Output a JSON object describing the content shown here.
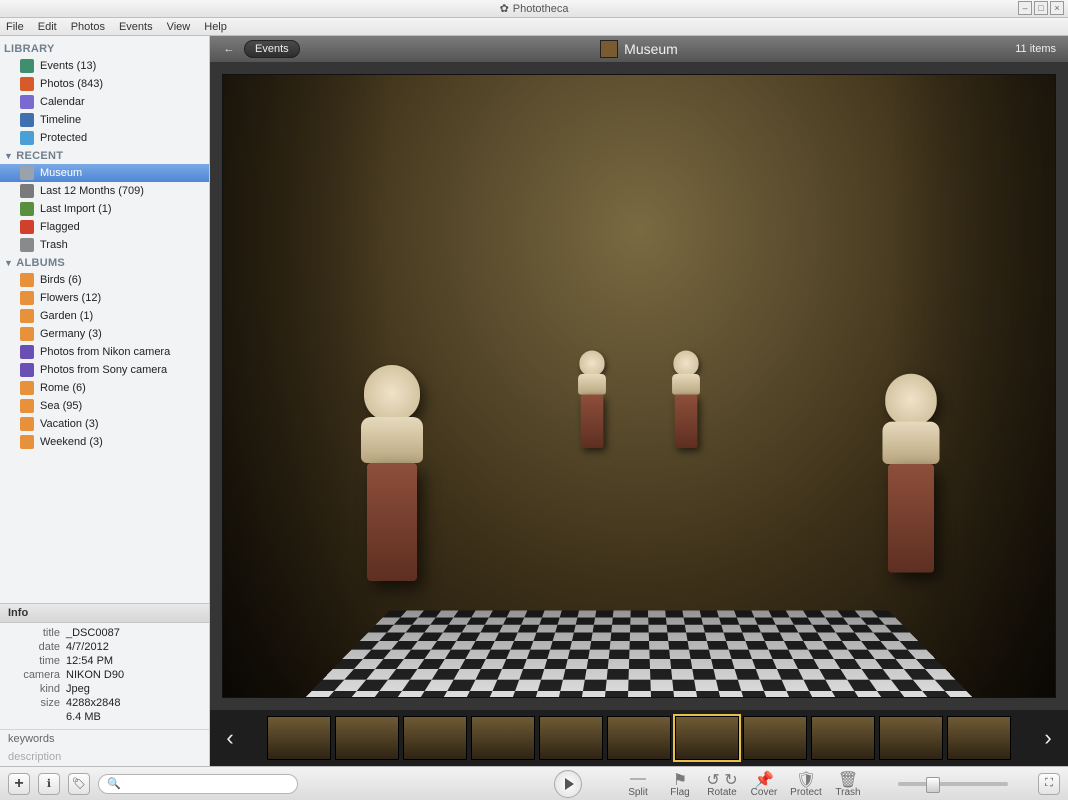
{
  "app_name": "Phototheca",
  "menus": [
    "File",
    "Edit",
    "Photos",
    "Events",
    "View",
    "Help"
  ],
  "window_controls": [
    "min",
    "max",
    "close"
  ],
  "sidebar": {
    "sections": [
      {
        "title": "LIBRARY",
        "collapsible": false,
        "items": [
          {
            "label": "Events (13)",
            "icon": "events-icon",
            "icon_bg": "#3f8f6f"
          },
          {
            "label": "Photos (843)",
            "icon": "photos-icon",
            "icon_bg": "#d65a2a"
          },
          {
            "label": "Calendar",
            "icon": "calendar-icon",
            "icon_bg": "#7a6ad0"
          },
          {
            "label": "Timeline",
            "icon": "timeline-icon",
            "icon_bg": "#3f6fae"
          },
          {
            "label": "Protected",
            "icon": "protected-icon",
            "icon_bg": "#4aa0d6"
          }
        ]
      },
      {
        "title": "RECENT",
        "collapsible": true,
        "items": [
          {
            "label": "Museum",
            "icon": "album-icon",
            "icon_bg": "#9aa3ac",
            "selected": true
          },
          {
            "label": "Last 12 Months (709)",
            "icon": "clock-icon",
            "icon_bg": "#7a7a7a"
          },
          {
            "label": "Last Import (1)",
            "icon": "import-icon",
            "icon_bg": "#5a8f3f"
          },
          {
            "label": "Flagged",
            "icon": "flag-icon",
            "icon_bg": "#d0402a"
          },
          {
            "label": "Trash",
            "icon": "trash-icon",
            "icon_bg": "#8a8a8a"
          }
        ]
      },
      {
        "title": "ALBUMS",
        "collapsible": true,
        "items": [
          {
            "label": "Birds (6)",
            "icon": "folder-icon",
            "icon_bg": "#e7913a"
          },
          {
            "label": "Flowers (12)",
            "icon": "folder-icon",
            "icon_bg": "#e7913a"
          },
          {
            "label": "Garden (1)",
            "icon": "folder-icon",
            "icon_bg": "#e7913a"
          },
          {
            "label": "Germany (3)",
            "icon": "folder-icon",
            "icon_bg": "#e7913a"
          },
          {
            "label": "Photos from Nikon camera",
            "icon": "smart-icon",
            "icon_bg": "#6a4fb5"
          },
          {
            "label": "Photos from Sony camera",
            "icon": "smart-icon",
            "icon_bg": "#6a4fb5"
          },
          {
            "label": "Rome (6)",
            "icon": "folder-icon",
            "icon_bg": "#e7913a"
          },
          {
            "label": "Sea (95)",
            "icon": "folder-icon",
            "icon_bg": "#e7913a"
          },
          {
            "label": "Vacation (3)",
            "icon": "folder-icon",
            "icon_bg": "#e7913a"
          },
          {
            "label": "Weekend (3)",
            "icon": "folder-icon",
            "icon_bg": "#e7913a"
          }
        ]
      }
    ]
  },
  "info_panel": {
    "heading": "Info",
    "rows": [
      {
        "label": "title",
        "value": "_DSC0087"
      },
      {
        "label": "date",
        "value": "4/7/2012"
      },
      {
        "label": "time",
        "value": "12:54 PM"
      },
      {
        "label": "camera",
        "value": "NIKON D90"
      },
      {
        "label": "kind",
        "value": "Jpeg"
      },
      {
        "label": "size",
        "value": "4288x2848"
      },
      {
        "label": "",
        "value": "6.4 MB"
      }
    ],
    "keywords_label": "keywords",
    "description_label": "description"
  },
  "content": {
    "breadcrumb_back_icon": "←",
    "breadcrumb_label": "Events",
    "title": "Museum",
    "item_count_label": "11 items",
    "thumbnails": {
      "count": 11,
      "selected_index": 6
    }
  },
  "bottom": {
    "add_label": "+",
    "tools": [
      {
        "name": "split",
        "label": "Split",
        "glyph": "⎯⎯"
      },
      {
        "name": "flag",
        "label": "Flag",
        "glyph": "⚑"
      },
      {
        "name": "rotate",
        "label": "Rotate",
        "glyph": "↺ ↻"
      },
      {
        "name": "cover",
        "label": "Cover",
        "glyph": "📌"
      },
      {
        "name": "protect",
        "label": "Protect",
        "glyph": "🛡"
      },
      {
        "name": "trash",
        "label": "Trash",
        "glyph": "🗑"
      }
    ],
    "search_placeholder": "",
    "fullscreen_glyph": "⛶"
  }
}
